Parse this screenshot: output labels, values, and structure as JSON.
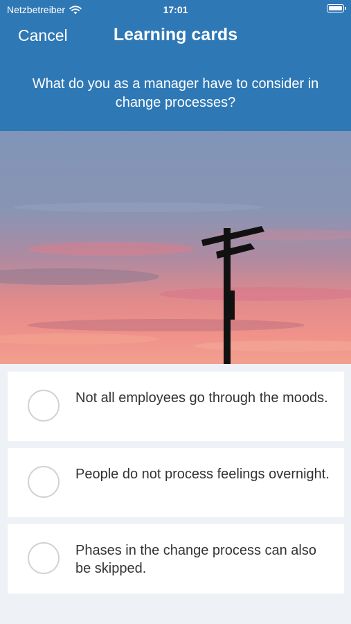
{
  "status_bar": {
    "carrier": "Netzbetreiber",
    "time": "17:01",
    "wifi_icon": "wifi-icon",
    "battery_icon": "battery-icon"
  },
  "nav": {
    "cancel_label": "Cancel",
    "title": "Learning cards"
  },
  "question": "What do you as a manager have to consider in change processes?",
  "image": {
    "description_icon": "signpost-sunset-image"
  },
  "answers": [
    {
      "text": "Not all employees go through the moods.",
      "selected": false
    },
    {
      "text": "People do not process feelings overnight.",
      "selected": false
    },
    {
      "text": "Phases in the change process can also be skipped.",
      "selected": false
    }
  ],
  "colors": {
    "header": "#2f78b6",
    "background": "#eef1f5",
    "radio_border": "#cfd2d6"
  }
}
